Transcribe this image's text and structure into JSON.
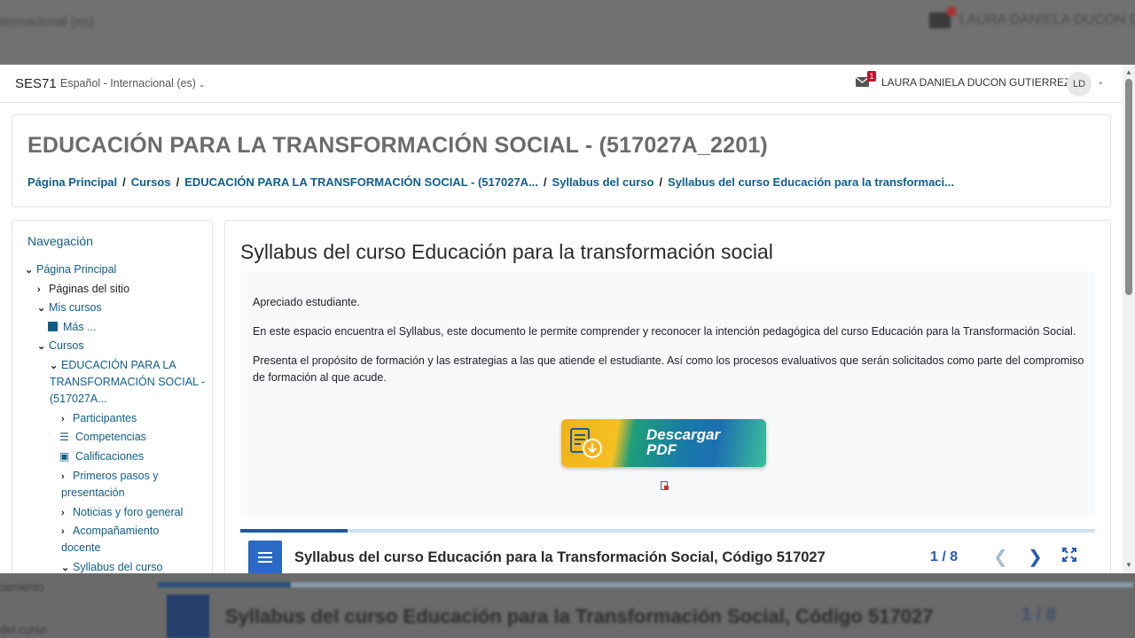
{
  "background": {
    "top_lang": "nternacional (es)",
    "top_user": "LAURA DANIELA DUCON GUTIERREZ",
    "bottom_left1": "tamiento",
    "bottom_left2": "del curso",
    "bottom_title": "Syllabus del curso Educación para la Transformación Social, Código 517027",
    "bottom_count": "1 / 8"
  },
  "navbar": {
    "brand": "SES71",
    "language": "Español - Internacional (es)",
    "notification_count": "1",
    "user_name": "LAURA DANIELA DUCON GUTIERREZ",
    "avatar_initials": "LD"
  },
  "header": {
    "course_title": "EDUCACIÓN PARA LA TRANSFORMACIÓN SOCIAL - (517027A_2201)",
    "breadcrumb": [
      "Página Principal",
      "Cursos",
      "EDUCACIÓN PARA LA TRANSFORMACIÓN SOCIAL - (517027A...",
      "Syllabus del curso",
      "Syllabus del curso Educación para la transformaci..."
    ]
  },
  "navigation": {
    "title": "Navegación",
    "items": {
      "pagina_principal": "Página Principal",
      "paginas_sitio": "Páginas del sitio",
      "mis_cursos": "Mis cursos",
      "mas": "Más ...",
      "cursos": "Cursos",
      "course_line1": "EDUCACIÓN PARA LA",
      "course_line2": "TRANSFORMACIÓN SOCIAL -",
      "course_line3": "(517027A...",
      "participantes": "Participantes",
      "competencias": "Competencias",
      "calificaciones": "Calificaciones",
      "primeros_line1": "Primeros pasos y",
      "primeros_line2": "presentación",
      "noticias": "Noticias y foro general",
      "acomp_line1": "Acompañamiento",
      "acomp_line2": "docente",
      "syllabus": "Syllabus del curso"
    }
  },
  "content": {
    "title": "Syllabus del curso Educación para la transformación social",
    "greeting": "Apreciado estudiante.",
    "paragraph1": "En este espacio encuentra el Syllabus, este documento le permite comprender y reconocer la intención pedagógica del curso Educación para la Transformación Social.",
    "paragraph2_line1": "Presenta el propósito de formación y las estrategias a las que atiende el estudiante. Así como los procesos evaluativos que serán solicitados como parte del compromiso",
    "paragraph2_line2": "de formación al que acude.",
    "pdf_button_line1": "Descargar",
    "pdf_button_line2": "PDF"
  },
  "viewer": {
    "title": "Syllabus del curso Educación para la Transformación Social, Código 517027",
    "page_indicator": "1 / 8",
    "progress": 0.125
  },
  "colors": {
    "link": "#0f5e8a",
    "accent_blue": "#2a69c6",
    "badge_red": "#c8102e"
  }
}
